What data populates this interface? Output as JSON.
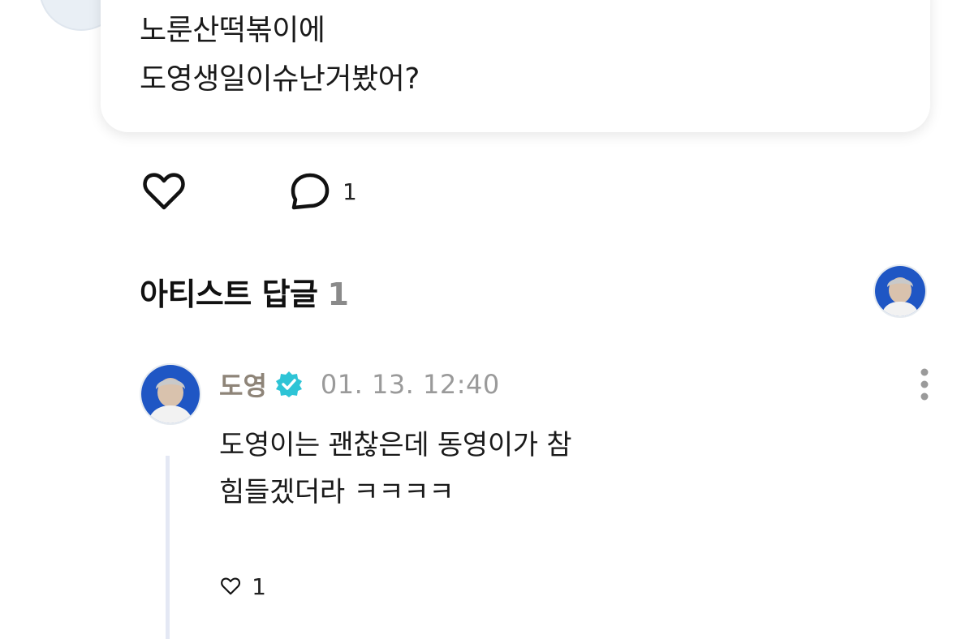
{
  "post": {
    "lines": [
      "노룬산떡볶이에",
      "도영생일이슈난거봤어?"
    ],
    "comment_count": "1"
  },
  "artist_replies": {
    "title": "아티스트 답글",
    "count": "1"
  },
  "reply": {
    "author": "도영",
    "timestamp": "01. 13. 12:40",
    "lines": [
      "도영이는 괜찮은데 동영이가 참",
      "힘들겠더라 ㅋㅋㅋㅋ"
    ],
    "like_count": "1"
  },
  "icons": {
    "like": "heart-outline-icon",
    "comment": "speech-bubble-icon",
    "verified": "verified-badge-icon",
    "more": "more-vertical-icon"
  },
  "colors": {
    "author": "#8e8478",
    "verified_badge": "#2ec4d6",
    "thread_line": "#e4e8f4",
    "avatar_bg": "#1f56c4"
  }
}
